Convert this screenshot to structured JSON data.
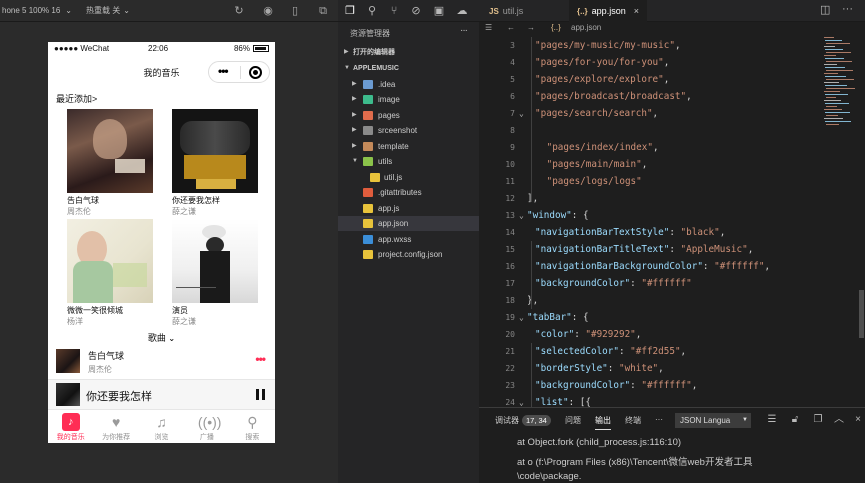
{
  "simulator": {
    "device_label": "hone 5 100% 16",
    "hot_reload_label": "热重载 关",
    "status_carrier": "●●●●● WeChat",
    "status_time": "22:06",
    "status_battery": "86%",
    "nav_title": "我的音乐",
    "section_recent": "最近添加>",
    "albums": [
      {
        "name": "告白气球",
        "artist": "周杰伦"
      },
      {
        "name": "你还要我怎样",
        "artist": "薛之谦"
      },
      {
        "name": "微微一笑很倾城",
        "artist": "杨洋"
      },
      {
        "name": "演员",
        "artist": "薛之谦"
      }
    ],
    "songs_header": "歌曲",
    "song_row": {
      "title": "告白气球",
      "artist": "周杰伦"
    },
    "mini_player_title": "你还要我怎样",
    "tabs": [
      {
        "label": "我的音乐",
        "icon": "music-note-icon"
      },
      {
        "label": "为你推荐",
        "icon": "heart-icon"
      },
      {
        "label": "浏览",
        "icon": "notes-icon"
      },
      {
        "label": "广播",
        "icon": "broadcast-icon"
      },
      {
        "label": "搜索",
        "icon": "search-icon"
      }
    ],
    "active_tab_color": "#ff2d55"
  },
  "explorer": {
    "title": "资源管理器",
    "open_editors": "打开的编辑器",
    "project": "APPLEMUSIC",
    "items": [
      {
        "label": ".idea",
        "type": "folder",
        "color": "#6b9bd1"
      },
      {
        "label": "image",
        "type": "folder",
        "color": "#3dbb8c"
      },
      {
        "label": "pages",
        "type": "folder",
        "color": "#e06c4c"
      },
      {
        "label": "srceenshot",
        "type": "folder",
        "color": "#8a8a8a"
      },
      {
        "label": "template",
        "type": "folder",
        "color": "#c48a5a"
      },
      {
        "label": "utils",
        "type": "folder",
        "color": "#8bc34a"
      },
      {
        "label": "util.js",
        "type": "file",
        "color": "#e8c33b"
      },
      {
        "label": ".gitattributes",
        "type": "file",
        "color": "#e05d3d"
      },
      {
        "label": "app.js",
        "type": "file",
        "color": "#e8c33b"
      },
      {
        "label": "app.json",
        "type": "file",
        "color": "#e8c33b"
      },
      {
        "label": "app.wxss",
        "type": "file",
        "color": "#3b8ed8"
      },
      {
        "label": "project.config.json",
        "type": "file",
        "color": "#e8c33b"
      }
    ]
  },
  "editor": {
    "tabs": [
      {
        "label": "util.js",
        "active": false
      },
      {
        "label": "app.json",
        "active": true
      }
    ],
    "breadcrumb": "app.json",
    "lines": [
      {
        "n": "3",
        "segs": [
          [
            "s",
            "\"pages/my-music/my-music\""
          ],
          [
            "p",
            ","
          ]
        ]
      },
      {
        "n": "4",
        "segs": [
          [
            "s",
            "\"pages/for-you/for-you\""
          ],
          [
            "p",
            ","
          ]
        ]
      },
      {
        "n": "5",
        "segs": [
          [
            "s",
            "\"pages/explore/explore\""
          ],
          [
            "p",
            ","
          ]
        ]
      },
      {
        "n": "6",
        "segs": [
          [
            "s",
            "\"pages/broadcast/broadcast\""
          ],
          [
            "p",
            ","
          ]
        ]
      },
      {
        "n": "7",
        "segs": [
          [
            "s",
            "\"pages/search/search\""
          ],
          [
            "p",
            ","
          ]
        ]
      },
      {
        "n": "8",
        "segs": []
      },
      {
        "n": "9",
        "segs": [
          [
            "s",
            " \"pages/index/index\""
          ],
          [
            "p",
            ","
          ]
        ]
      },
      {
        "n": "10",
        "segs": [
          [
            "s",
            " \"pages/main/main\""
          ],
          [
            "p",
            ","
          ]
        ]
      },
      {
        "n": "11",
        "segs": [
          [
            "s",
            " \"pages/logs/logs\""
          ]
        ]
      },
      {
        "n": "12",
        "segs": [
          [
            "p",
            "],"
          ]
        ]
      },
      {
        "n": "13",
        "segs": [
          [
            "k",
            "\"window\""
          ],
          [
            "p",
            ": {"
          ]
        ]
      },
      {
        "n": "14",
        "segs": [
          [
            "k",
            "\"navigationBarTextStyle\""
          ],
          [
            "p",
            ": "
          ],
          [
            "s",
            "\"black\""
          ],
          [
            "p",
            ","
          ]
        ]
      },
      {
        "n": "15",
        "segs": [
          [
            "k",
            "\"navigationBarTitleText\""
          ],
          [
            "p",
            ": "
          ],
          [
            "s",
            "\"AppleMusic\""
          ],
          [
            "p",
            ","
          ]
        ]
      },
      {
        "n": "16",
        "segs": [
          [
            "k",
            "\"navigationBarBackgroundColor\""
          ],
          [
            "p",
            ": "
          ],
          [
            "s",
            "\"#ffffff\""
          ],
          [
            "p",
            ","
          ]
        ]
      },
      {
        "n": "17",
        "segs": [
          [
            "k",
            "\"backgroundColor\""
          ],
          [
            "p",
            ": "
          ],
          [
            "s",
            "\"#ffffff\""
          ]
        ]
      },
      {
        "n": "18",
        "segs": [
          [
            "p",
            "},"
          ]
        ]
      },
      {
        "n": "19",
        "segs": [
          [
            "k",
            "\"tabBar\""
          ],
          [
            "p",
            ": {"
          ]
        ]
      },
      {
        "n": "20",
        "segs": [
          [
            "k",
            "\"color\""
          ],
          [
            "p",
            ": "
          ],
          [
            "s",
            "\"#929292\""
          ],
          [
            "p",
            ","
          ]
        ]
      },
      {
        "n": "21",
        "segs": [
          [
            "k",
            "\"selectedColor\""
          ],
          [
            "p",
            ": "
          ],
          [
            "s",
            "\"#ff2d55\""
          ],
          [
            "p",
            ","
          ]
        ]
      },
      {
        "n": "22",
        "segs": [
          [
            "k",
            "\"borderStyle\""
          ],
          [
            "p",
            ": "
          ],
          [
            "s",
            "\"white\""
          ],
          [
            "p",
            ","
          ]
        ]
      },
      {
        "n": "23",
        "segs": [
          [
            "k",
            "\"backgroundColor\""
          ],
          [
            "p",
            ": "
          ],
          [
            "s",
            "\"#ffffff\""
          ],
          [
            "p",
            ","
          ]
        ]
      },
      {
        "n": "24",
        "segs": [
          [
            "k",
            "\"list\""
          ],
          [
            "p",
            ": [{"
          ]
        ]
      }
    ]
  },
  "panel": {
    "tabs": [
      {
        "label": "调试器",
        "badge": "17, 34"
      },
      {
        "label": "问题",
        "badge": ""
      },
      {
        "label": "输出",
        "badge": ""
      },
      {
        "label": "终端",
        "badge": ""
      }
    ],
    "more": "···",
    "language": "JSON Langua",
    "output_lines": [
      "at Object.fork (child_process.js:116:10)",
      "at o (f:\\Program Files (x86)\\Tencent\\微信web开发者工具",
      "\\code\\package."
    ]
  }
}
